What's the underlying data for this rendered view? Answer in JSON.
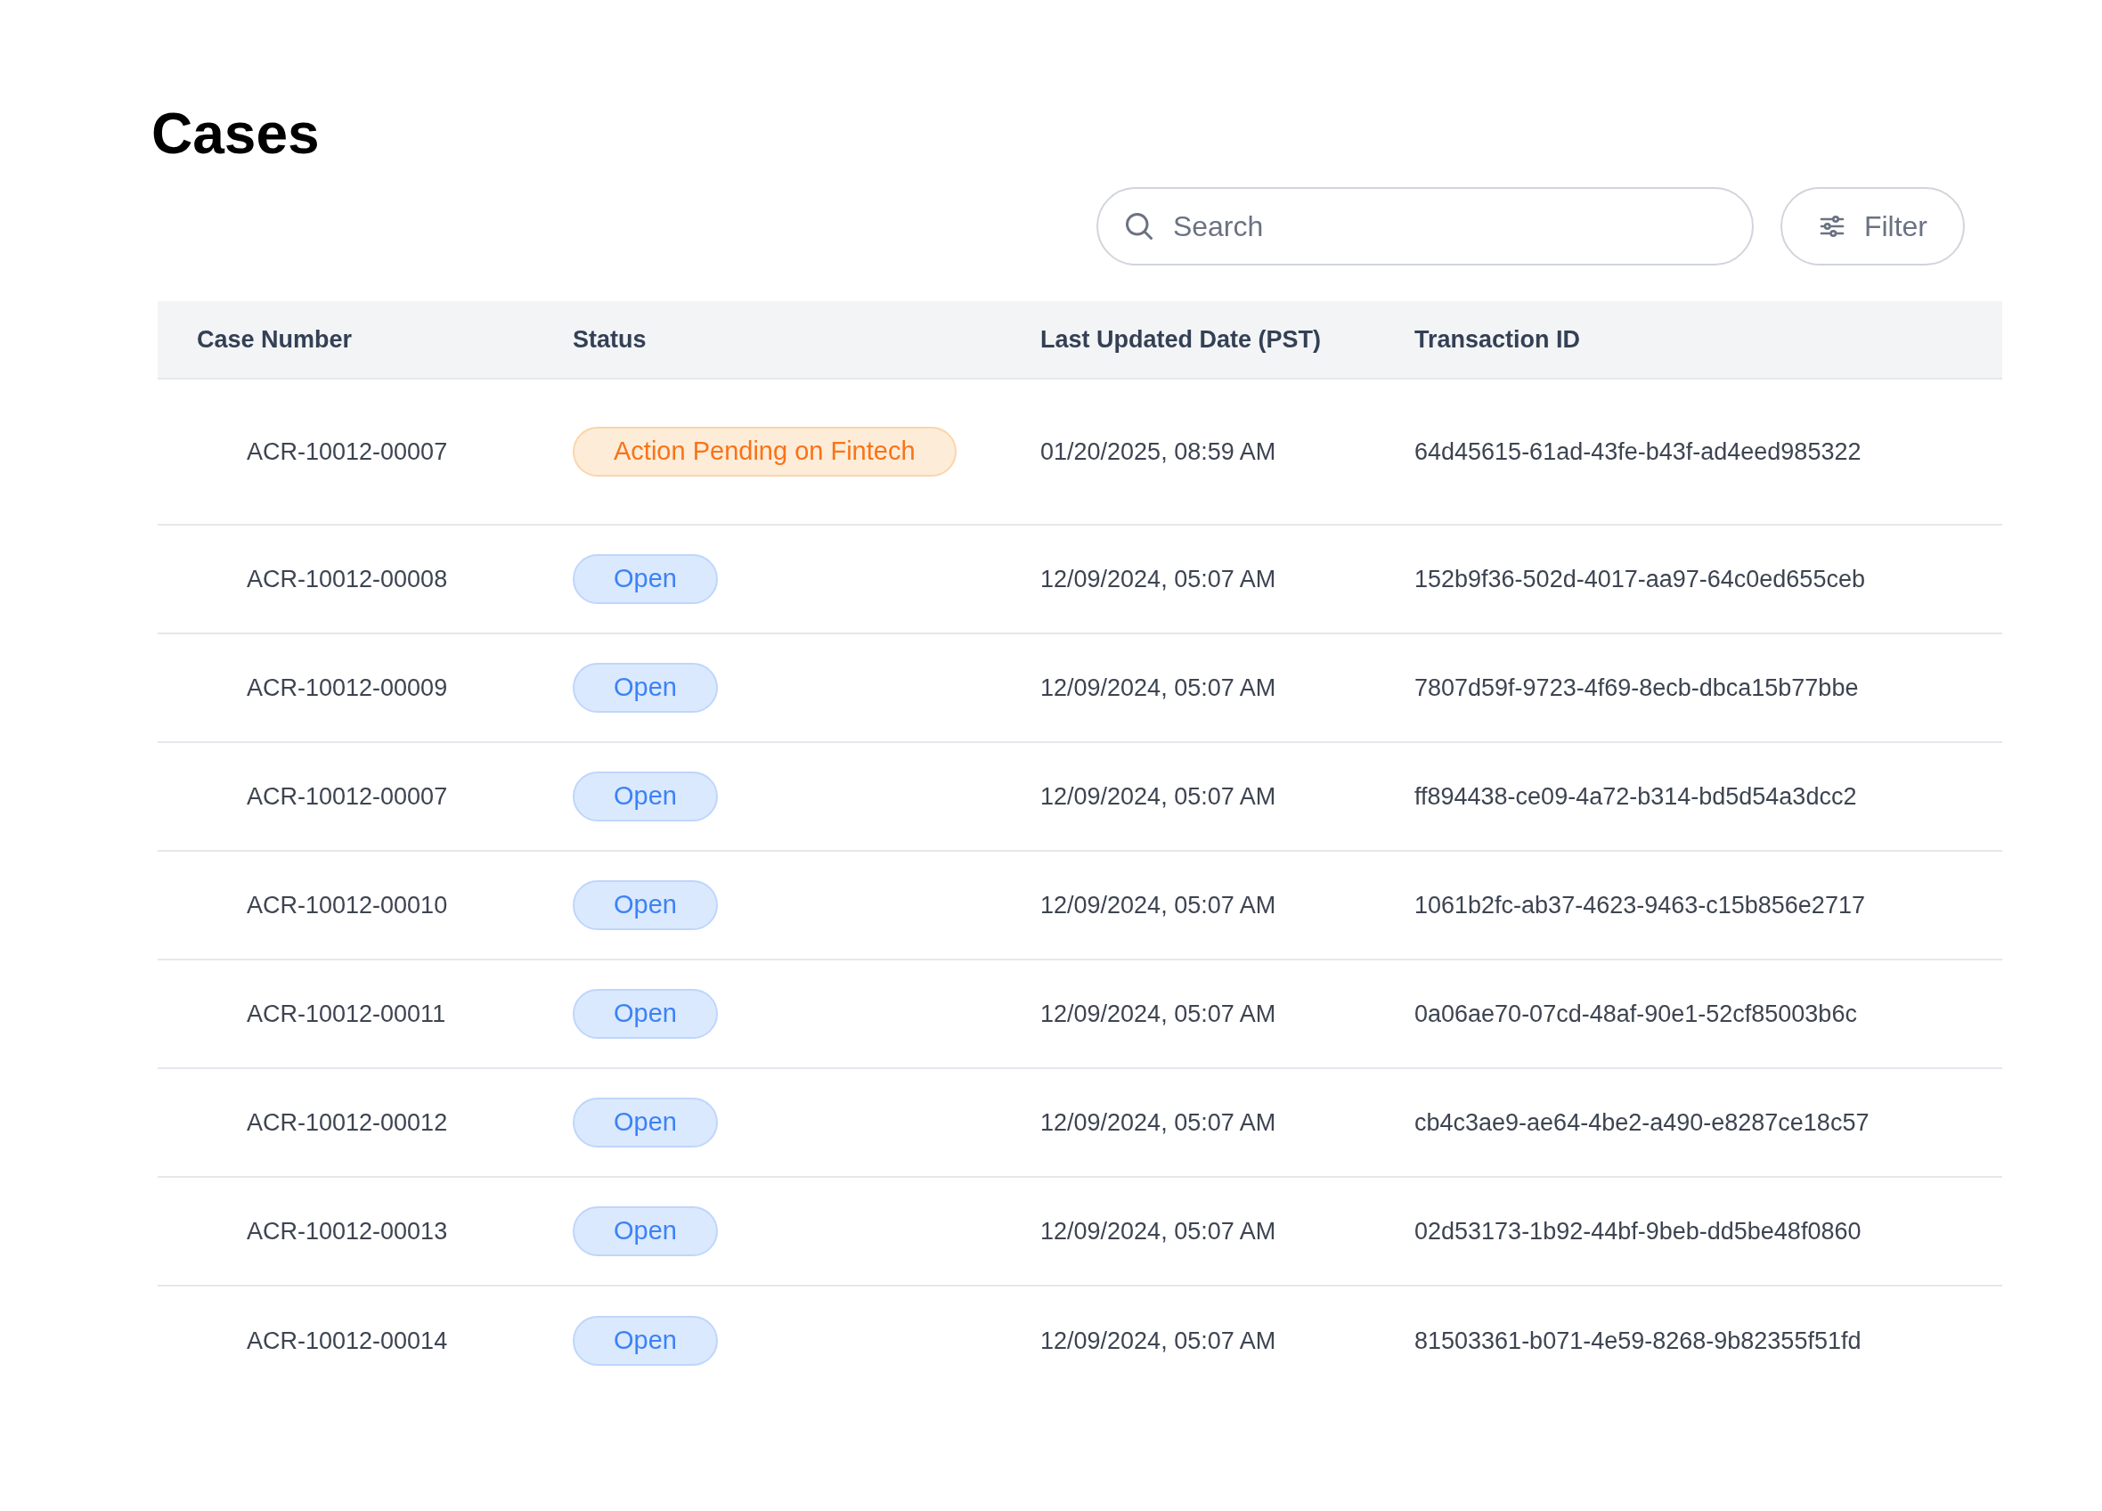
{
  "page_title": "Cases",
  "search": {
    "placeholder": "Search"
  },
  "filter_button": {
    "label": "Filter"
  },
  "table": {
    "columns": [
      "Case Number",
      "Status",
      "Last Updated Date (PST)",
      "Transaction ID"
    ],
    "rows": [
      {
        "case_number": "ACR-10012-00007",
        "status": {
          "label": "Action Pending on Fintech",
          "kind": "pending"
        },
        "last_updated": "01/20/2025, 08:59 AM",
        "transaction_id": "64d45615-61ad-43fe-b43f-ad4eed985322"
      },
      {
        "case_number": "ACR-10012-00008",
        "status": {
          "label": "Open",
          "kind": "open"
        },
        "last_updated": "12/09/2024, 05:07 AM",
        "transaction_id": "152b9f36-502d-4017-aa97-64c0ed655ceb"
      },
      {
        "case_number": "ACR-10012-00009",
        "status": {
          "label": "Open",
          "kind": "open"
        },
        "last_updated": "12/09/2024, 05:07 AM",
        "transaction_id": "7807d59f-9723-4f69-8ecb-dbca15b77bbe"
      },
      {
        "case_number": "ACR-10012-00007",
        "status": {
          "label": "Open",
          "kind": "open"
        },
        "last_updated": "12/09/2024, 05:07 AM",
        "transaction_id": "ff894438-ce09-4a72-b314-bd5d54a3dcc2"
      },
      {
        "case_number": "ACR-10012-00010",
        "status": {
          "label": "Open",
          "kind": "open"
        },
        "last_updated": "12/09/2024, 05:07 AM",
        "transaction_id": "1061b2fc-ab37-4623-9463-c15b856e2717"
      },
      {
        "case_number": "ACR-10012-00011",
        "status": {
          "label": "Open",
          "kind": "open"
        },
        "last_updated": "12/09/2024, 05:07 AM",
        "transaction_id": "0a06ae70-07cd-48af-90e1-52cf85003b6c"
      },
      {
        "case_number": "ACR-10012-00012",
        "status": {
          "label": "Open",
          "kind": "open"
        },
        "last_updated": "12/09/2024, 05:07 AM",
        "transaction_id": "cb4c3ae9-ae64-4be2-a490-e8287ce18c57"
      },
      {
        "case_number": "ACR-10012-00013",
        "status": {
          "label": "Open",
          "kind": "open"
        },
        "last_updated": "12/09/2024, 05:07 AM",
        "transaction_id": "02d53173-1b92-44bf-9beb-dd5be48f0860"
      },
      {
        "case_number": "ACR-10012-00014",
        "status": {
          "label": "Open",
          "kind": "open"
        },
        "last_updated": "12/09/2024, 05:07 AM",
        "transaction_id": "81503361-b071-4e59-8268-9b82355f51fd"
      }
    ]
  }
}
